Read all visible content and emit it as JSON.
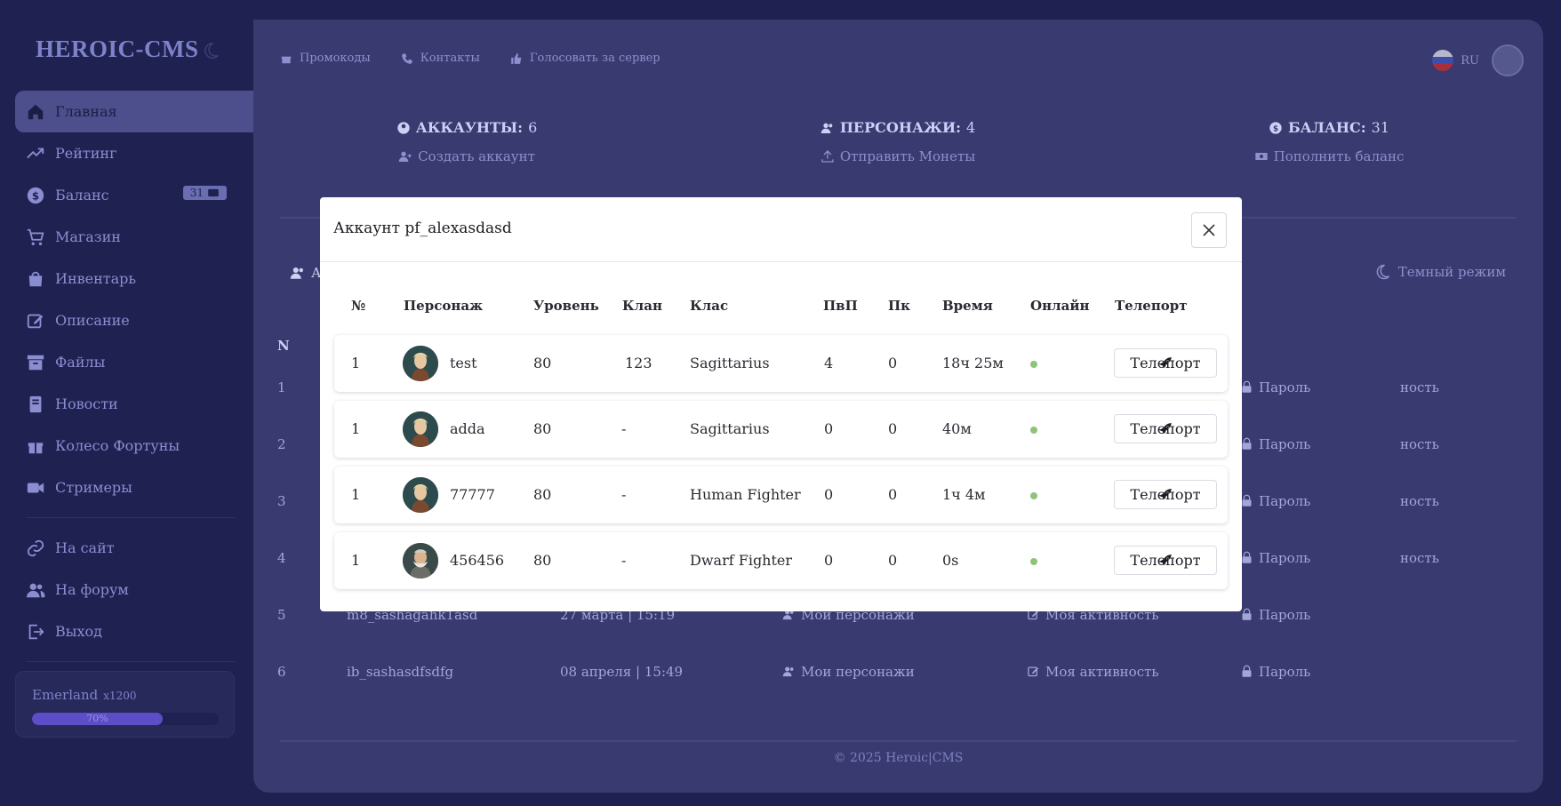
{
  "sidebar": {
    "logo": "HEROIC-CMS",
    "items": [
      {
        "label": "Главная",
        "icon": "home-icon"
      },
      {
        "label": "Рейтинг",
        "icon": "trend-icon"
      },
      {
        "label": "Баланс",
        "icon": "dollar-icon",
        "badge": "31"
      },
      {
        "label": "Магазин",
        "icon": "cart-icon"
      },
      {
        "label": "Инвентарь",
        "icon": "bag-icon"
      },
      {
        "label": "Описание",
        "icon": "edit-icon"
      },
      {
        "label": "Файлы",
        "icon": "archive-icon"
      },
      {
        "label": "Новости",
        "icon": "news-icon"
      },
      {
        "label": "Колесо Фортуны",
        "icon": "gift-icon"
      },
      {
        "label": "Стримеры",
        "icon": "video-icon"
      }
    ],
    "links": [
      {
        "label": "На сайт",
        "icon": "link-icon"
      },
      {
        "label": "На форум",
        "icon": "users-icon"
      },
      {
        "label": "Выход",
        "icon": "logout-icon"
      }
    ],
    "server": {
      "name": "Emerland",
      "rate": "x1200",
      "progress_label": "70%",
      "progress": 0.7
    }
  },
  "topbar": {
    "links": [
      "Промокоды",
      "Контакты",
      "Голосовать за сервер"
    ],
    "lang": "RU"
  },
  "stats": [
    {
      "title": "АККАУНТЫ:",
      "value": "6",
      "link": "Создать аккаунт"
    },
    {
      "title": "ПЕРСОНАЖИ:",
      "value": "4",
      "link": "Отправить Монеты"
    },
    {
      "title": "БАЛАНС:",
      "value": "31",
      "link": "Пополнить баланс"
    }
  ],
  "dark_mode_label": "Темный режим",
  "section_letter": "А",
  "bg_table": {
    "head": "N",
    "rows": [
      {
        "n": "1",
        "name": "",
        "date": "",
        "chars": "",
        "activity": "ность",
        "pass": "Пароль"
      },
      {
        "n": "2",
        "name": "",
        "date": "",
        "chars": "",
        "activity": "ность",
        "pass": "Пароль"
      },
      {
        "n": "3",
        "name": "",
        "date": "",
        "chars": "",
        "activity": "ность",
        "pass": "Пароль"
      },
      {
        "n": "4",
        "name": "",
        "date": "",
        "chars": "",
        "activity": "ность",
        "pass": "Пароль"
      },
      {
        "n": "5",
        "name": "m8_sashagahk1asd",
        "date": "27 марта | 15:19",
        "chars": "Мои персонажи",
        "activity": "Моя активность",
        "pass": "Пароль"
      },
      {
        "n": "6",
        "name": "ib_sashasdfsdfg",
        "date": "08 апреля | 15:49",
        "chars": "Мои персонажи",
        "activity": "Моя активность",
        "pass": "Пароль"
      }
    ]
  },
  "footer": "© 2025 Heroic|CMS",
  "modal": {
    "title": "Аккаунт pf_alexasdasd",
    "columns": [
      "№",
      "Персонаж",
      "Уровень",
      "Клан",
      "Клас",
      "ПвП",
      "Пк",
      "Время",
      "Онлайн",
      "Телепорт"
    ],
    "rows": [
      {
        "num": "1",
        "name": "test",
        "level": "80",
        "clan": "123",
        "class": "Sagittarius",
        "pvp": "4",
        "pk": "0",
        "time": "18ч 25м",
        "teleport": "Телепорт",
        "avatar": "elf"
      },
      {
        "num": "1",
        "name": "adda",
        "level": "80",
        "clan": "-",
        "class": "Sagittarius",
        "pvp": "0",
        "pk": "0",
        "time": "40м",
        "teleport": "Телепорт",
        "avatar": "elf"
      },
      {
        "num": "1",
        "name": "77777",
        "level": "80",
        "clan": "-",
        "class": "Human Fighter",
        "pvp": "0",
        "pk": "0",
        "time": "1ч 4м",
        "teleport": "Телепорт",
        "avatar": "elf"
      },
      {
        "num": "1",
        "name": "456456",
        "level": "80",
        "clan": "-",
        "class": "Dwarf Fighter",
        "pvp": "0",
        "pk": "0",
        "time": "0s",
        "teleport": "Телепорт",
        "avatar": "dwarf"
      }
    ]
  },
  "colors": {
    "bg": "#1f2150",
    "panel": "#383a70",
    "online": "#8fc27a",
    "progress": "#5b4ec7"
  }
}
